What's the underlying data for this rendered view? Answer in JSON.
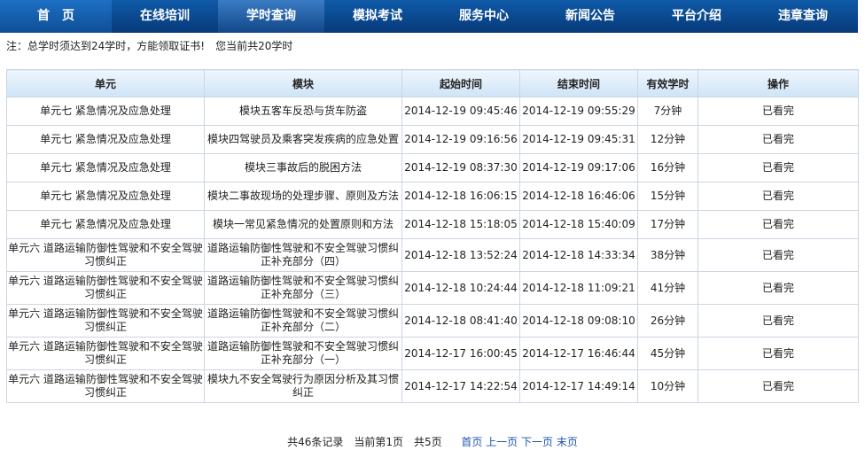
{
  "nav": {
    "items": [
      "首　页",
      "在线培训",
      "学时查询",
      "模拟考试",
      "服务中心",
      "新闻公告",
      "平台介绍",
      "违章查询"
    ],
    "active_index": 2
  },
  "notice": "注：总学时须达到24学时，方能领取证书!　您当前共20学时",
  "table": {
    "headers": [
      "单元",
      "模块",
      "起始时间",
      "结束时间",
      "有效学时",
      "操作"
    ],
    "rows": [
      [
        "单元七 紧急情况及应急处理",
        "模块五客车反恐与货车防盗",
        "2014-12-19 09:45:46",
        "2014-12-19 09:55:29",
        "7分钟",
        "已看完"
      ],
      [
        "单元七 紧急情况及应急处理",
        "模块四驾驶员及乘客突发疾病的应急处置",
        "2014-12-19 09:16:56",
        "2014-12-19 09:45:31",
        "12分钟",
        "已看完"
      ],
      [
        "单元七 紧急情况及应急处理",
        "模块三事故后的脱困方法",
        "2014-12-19 08:37:30",
        "2014-12-19 09:17:06",
        "16分钟",
        "已看完"
      ],
      [
        "单元七 紧急情况及应急处理",
        "模块二事故现场的处理步骤、原则及方法",
        "2014-12-18 16:06:15",
        "2014-12-18 16:46:06",
        "15分钟",
        "已看完"
      ],
      [
        "单元七 紧急情况及应急处理",
        "模块一常见紧急情况的处置原则和方法",
        "2014-12-18 15:18:05",
        "2014-12-18 15:40:09",
        "17分钟",
        "已看完"
      ],
      [
        "单元六 道路运输防御性驾驶和不安全驾驶习惯纠正",
        "道路运输防御性驾驶和不安全驾驶习惯纠正补充部分（四）",
        "2014-12-18 13:52:24",
        "2014-12-18 14:33:34",
        "38分钟",
        "已看完"
      ],
      [
        "单元六 道路运输防御性驾驶和不安全驾驶习惯纠正",
        "道路运输防御性驾驶和不安全驾驶习惯纠正补充部分（三）",
        "2014-12-18 10:24:44",
        "2014-12-18 11:09:21",
        "41分钟",
        "已看完"
      ],
      [
        "单元六 道路运输防御性驾驶和不安全驾驶习惯纠正",
        "道路运输防御性驾驶和不安全驾驶习惯纠正补充部分（二）",
        "2014-12-18 08:41:40",
        "2014-12-18 09:08:10",
        "26分钟",
        "已看完"
      ],
      [
        "单元六 道路运输防御性驾驶和不安全驾驶习惯纠正",
        "道路运输防御性驾驶和不安全驾驶习惯纠正补充部分（一）",
        "2014-12-17 16:00:45",
        "2014-12-17 16:46:44",
        "45分钟",
        "已看完"
      ],
      [
        "单元六 道路运输防御性驾驶和不安全驾驶习惯纠正",
        "模块九不安全驾驶行为原因分析及其习惯纠正",
        "2014-12-17 14:22:54",
        "2014-12-17 14:49:14",
        "10分钟",
        "已看完"
      ]
    ]
  },
  "pager": {
    "summary": "共46条记录　当前第1页　共5页",
    "first": "首页",
    "prev": "上一页",
    "next": "下一页",
    "last": "末页"
  },
  "colors": {
    "nav_bg": "#073a7a",
    "header_bg": "#cfe4f7",
    "border": "#cbd6e2",
    "link": "#1e56b0"
  }
}
